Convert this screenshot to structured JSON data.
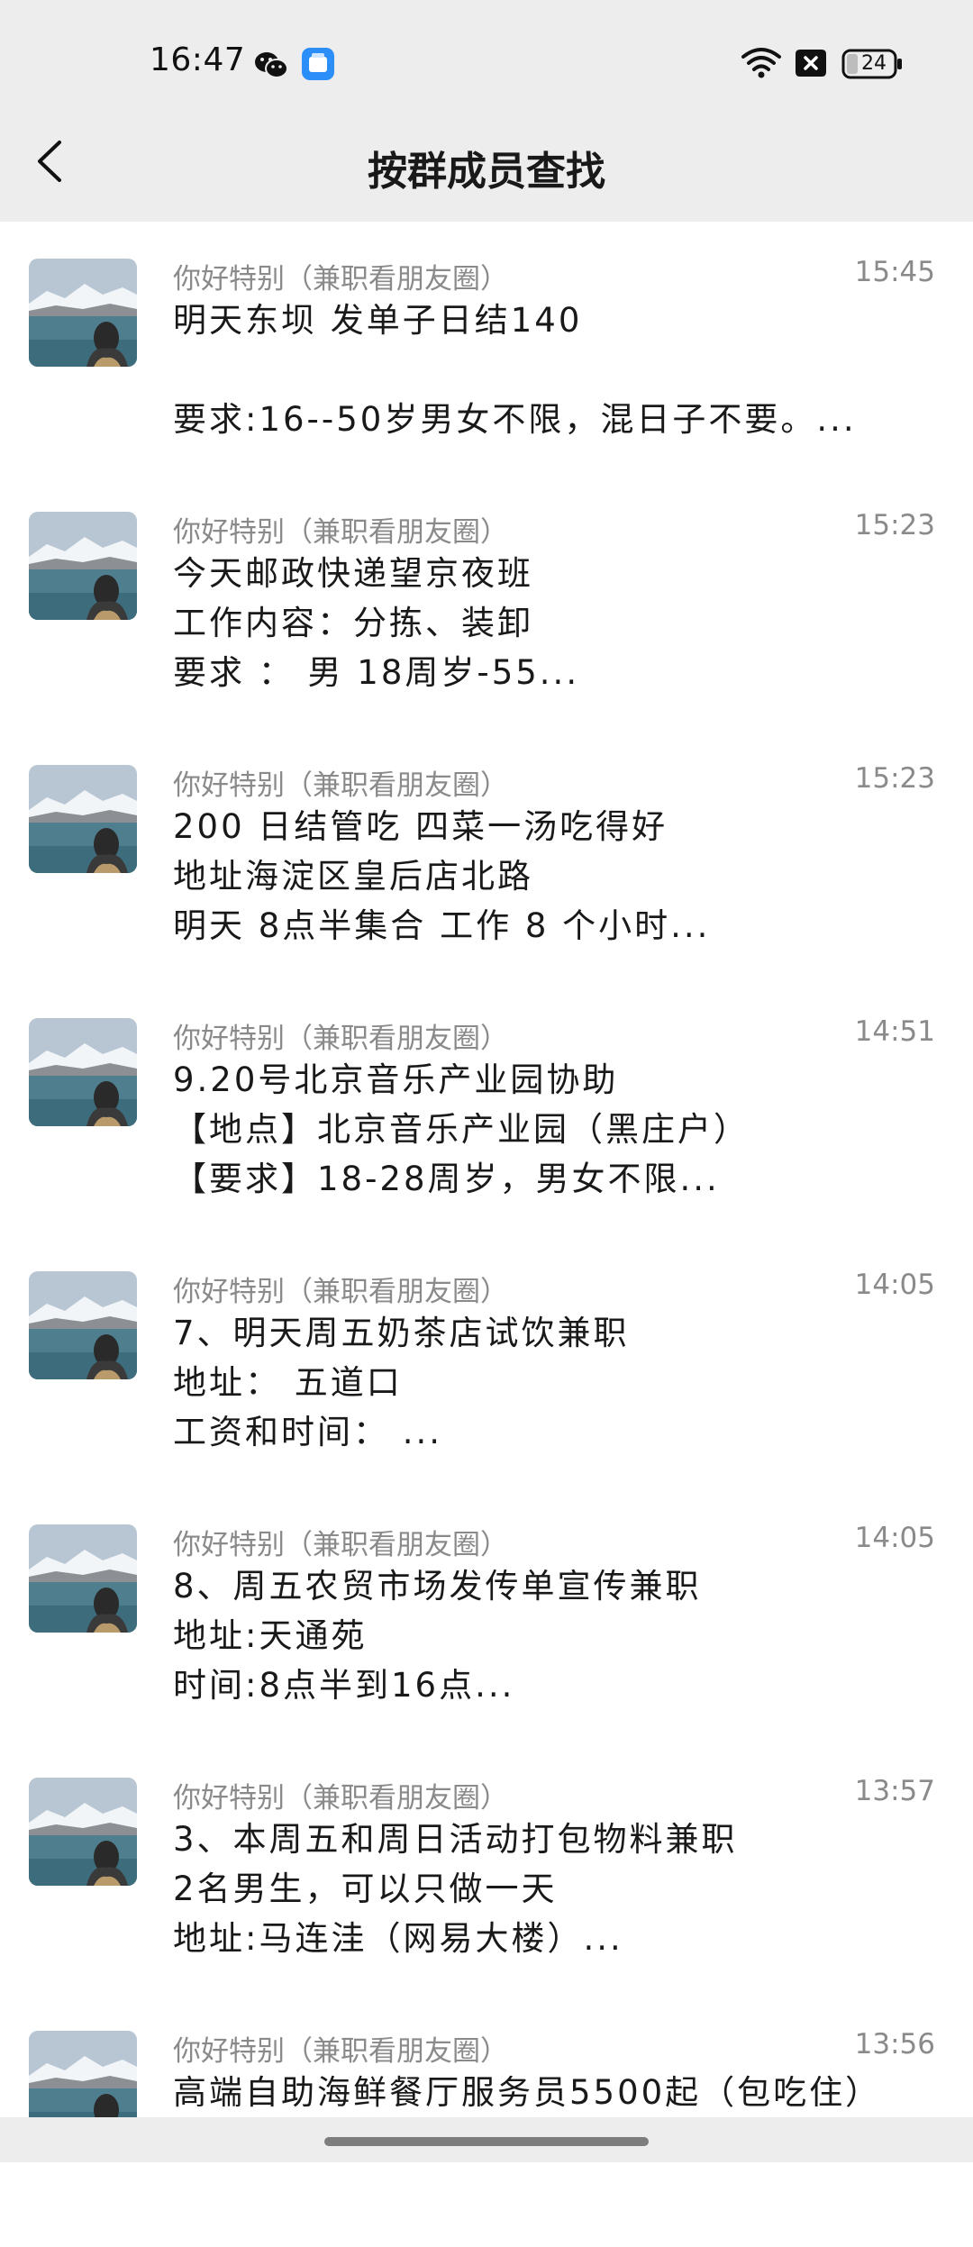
{
  "status_bar": {
    "time": "16:47",
    "battery": "24",
    "icons": [
      "wechat-icon",
      "app-notification-icon",
      "wifi-icon",
      "sim-disabled-icon",
      "battery-icon"
    ]
  },
  "header": {
    "title": "按群成员查找",
    "back_icon": "chevron-left-icon"
  },
  "items": [
    {
      "sender": "你好特别（兼职看朋友圈）",
      "time": "15:45",
      "lines": [
        "明天东坝 发单子日结140",
        "",
        "要求:16--50岁男女不限，混日子不要。..."
      ]
    },
    {
      "sender": "你好特别（兼职看朋友圈）",
      "time": "15:23",
      "lines": [
        "今天邮政快递望京夜班",
        "工作内容：分拣、装卸",
        "要求 ： 男 18周岁-55..."
      ]
    },
    {
      "sender": "你好特别（兼职看朋友圈）",
      "time": "15:23",
      "lines": [
        "200 日结管吃 四菜一汤吃得好",
        "地址海淀区皇后店北路",
        "明天 8点半集合 工作 8 个小时..."
      ]
    },
    {
      "sender": "你好特别（兼职看朋友圈）",
      "time": "14:51",
      "lines": [
        "9.20号北京音乐产业园协助",
        "【地点】北京音乐产业园（黑庄户）",
        "【要求】18-28周岁，男女不限..."
      ]
    },
    {
      "sender": "你好特别（兼职看朋友圈）",
      "time": "14:05",
      "lines": [
        "7、明天周五奶茶店试饮兼职",
        "地址： 五道口",
        "工资和时间： ..."
      ]
    },
    {
      "sender": "你好特别（兼职看朋友圈）",
      "time": "14:05",
      "lines": [
        "8、周五农贸市场发传单宣传兼职",
        "地址:天通苑",
        "时间:8点半到16点..."
      ]
    },
    {
      "sender": "你好特别（兼职看朋友圈）",
      "time": "13:57",
      "lines": [
        "3、本周五和周日活动打包物料兼职",
        "2名男生，可以只做一天",
        "地址:马连洼（网易大楼）..."
      ]
    },
    {
      "sender": "你好特别（兼职看朋友圈）",
      "time": "13:56",
      "lines": [
        "高端自助海鲜餐厅服务员5500起（包吃住）",
        "",
        ""
      ]
    }
  ]
}
